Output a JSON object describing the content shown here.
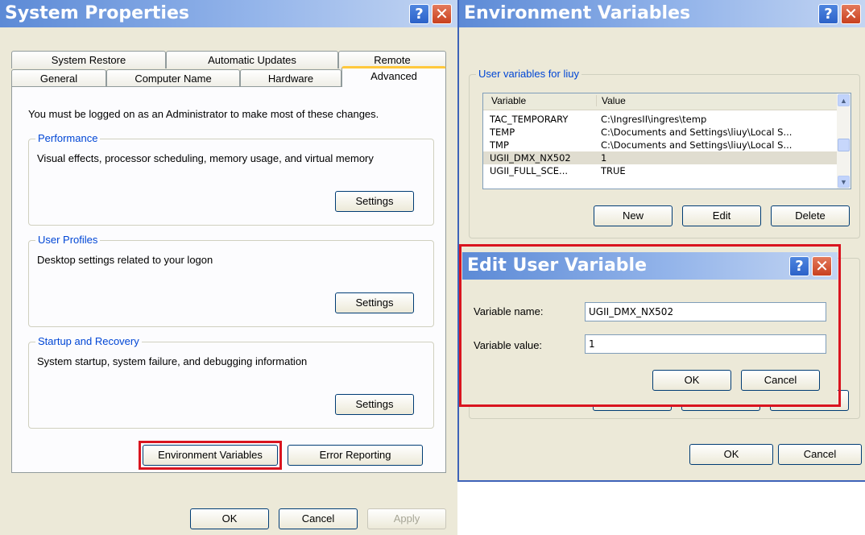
{
  "system_properties": {
    "title": "System Properties",
    "tabs_row1": [
      "System Restore",
      "Automatic Updates",
      "Remote"
    ],
    "tabs_row2": [
      "General",
      "Computer Name",
      "Hardware",
      "Advanced"
    ],
    "active_tab": "Advanced",
    "admin_note": "You must be logged on as an Administrator to make most of these changes.",
    "performance": {
      "label": "Performance",
      "description": "Visual effects, processor scheduling, memory usage, and virtual memory",
      "button": "Settings"
    },
    "user_profiles": {
      "label": "User Profiles",
      "description": "Desktop settings related to your logon",
      "button": "Settings"
    },
    "startup_recovery": {
      "label": "Startup and Recovery",
      "description": "System startup, system failure, and debugging information",
      "button": "Settings"
    },
    "env_vars_button": "Environment Variables",
    "error_reporting_button": "Error Reporting",
    "ok": "OK",
    "cancel": "Cancel",
    "apply": "Apply"
  },
  "environment_variables": {
    "title": "Environment Variables",
    "user_vars_label": "User variables for liuy",
    "columns": [
      "Variable",
      "Value"
    ],
    "rows": [
      {
        "variable": "TAC_TEMPORARY",
        "value": "C:\\IngresII\\ingres\\temp"
      },
      {
        "variable": "TEMP",
        "value": "C:\\Documents and Settings\\liuy\\Local S..."
      },
      {
        "variable": "TMP",
        "value": "C:\\Documents and Settings\\liuy\\Local S..."
      },
      {
        "variable": "UGII_DMX_NX502",
        "value": "1"
      },
      {
        "variable": "UGII_FULL_SCE...",
        "value": "TRUE"
      }
    ],
    "selected_row": 3,
    "new": "New",
    "edit": "Edit",
    "delete": "Delete",
    "ok": "OK",
    "cancel": "Cancel"
  },
  "edit_user_variable": {
    "title": "Edit User Variable",
    "name_label": "Variable name:",
    "name_value": "UGII_DMX_NX502",
    "value_label": "Variable value:",
    "value_value": "1",
    "ok": "OK",
    "cancel": "Cancel"
  },
  "icons": {
    "help": "?",
    "close": "✕",
    "scroll_up": "▲",
    "scroll_down": "▼"
  },
  "colors": {
    "highlight": "#d9141f",
    "group_label": "#0046d5",
    "titlebar": "#5c8ad6"
  }
}
